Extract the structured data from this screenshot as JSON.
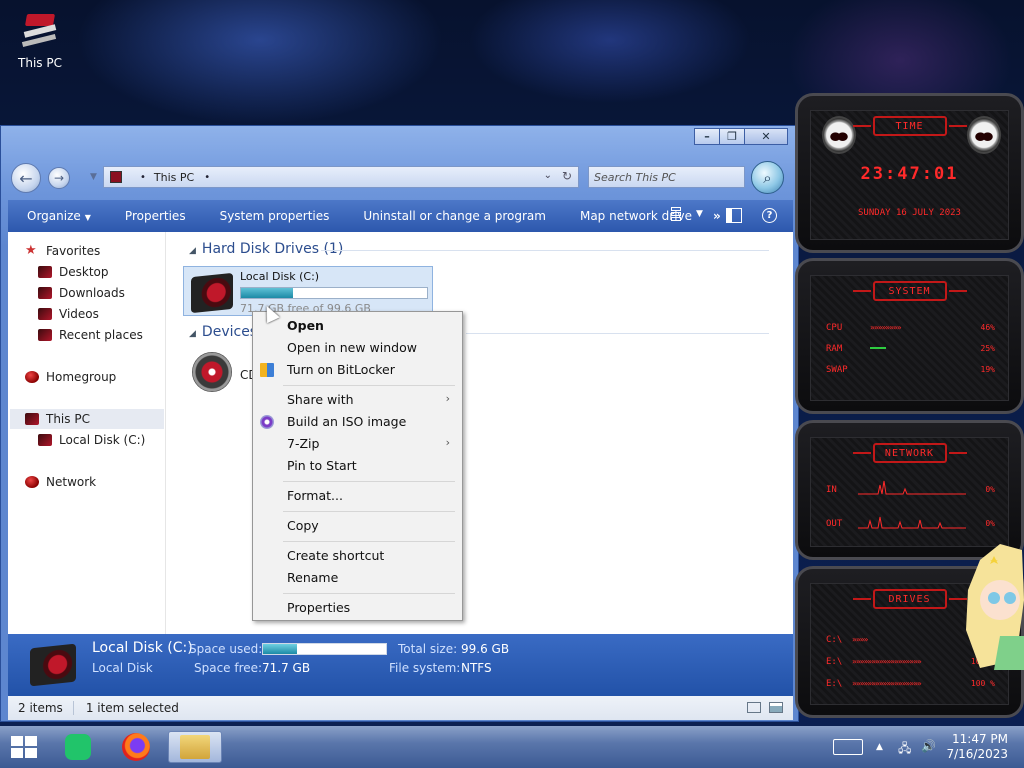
{
  "desktop": {
    "this_pc_label": "This PC"
  },
  "window": {
    "address": {
      "location": "This PC",
      "separator": "•"
    },
    "search_placeholder": "Search This PC",
    "caption_buttons": {
      "minimize": "–",
      "maximize": "❐",
      "close": "✕"
    },
    "commands": {
      "organize": "Organize",
      "properties": "Properties",
      "system_properties": "System properties",
      "uninstall": "Uninstall or change a program",
      "map_drive": "Map network drive",
      "more": "»"
    },
    "nav": {
      "favorites": "Favorites",
      "desktop": "Desktop",
      "downloads": "Downloads",
      "videos": "Videos",
      "recent": "Recent places",
      "homegroup": "Homegroup",
      "this_pc": "This PC",
      "local_disk": "Local Disk (C:)",
      "network": "Network"
    },
    "groups": {
      "hdd": "Hard Disk Drives (1)",
      "devices": "Devices w"
    },
    "drive": {
      "name": "Local Disk (C:)",
      "free_text": "71.7 GB free of 99.6 GB",
      "used_fraction": 0.28
    },
    "cd": {
      "label": "CD"
    },
    "details": {
      "name": "Local Disk (C:)",
      "type": "Local Disk",
      "space_used_label": "Space used:",
      "space_free_label": "Space free:",
      "space_free": "71.7 GB",
      "total_size_label": "Total size:",
      "total_size": "99.6 GB",
      "file_system_label": "File system:",
      "file_system": "NTFS",
      "used_fraction": 0.28
    },
    "status": {
      "items": "2 items",
      "selected": "1 item selected"
    }
  },
  "context_menu": {
    "open": "Open",
    "open_new_window": "Open in new window",
    "bitlocker": "Turn on BitLocker",
    "share_with": "Share with",
    "build_iso": "Build an ISO image",
    "seven_zip": "7-Zip",
    "pin_start": "Pin to Start",
    "format": "Format...",
    "copy": "Copy",
    "create_shortcut": "Create shortcut",
    "rename": "Rename",
    "properties": "Properties"
  },
  "widgets": {
    "time": {
      "title": "TIME",
      "clock": "23:47:01",
      "date": "SUNDAY 16 JULY 2023"
    },
    "system": {
      "title": "SYSTEM",
      "rows": [
        {
          "label": "CPU",
          "value": "46%"
        },
        {
          "label": "RAM",
          "value": "25%"
        },
        {
          "label": "SWAP",
          "value": "19%"
        }
      ]
    },
    "network": {
      "title": "NETWORK",
      "rows": [
        {
          "label": "IN",
          "value": "0%"
        },
        {
          "label": "OUT",
          "value": "0%"
        }
      ]
    },
    "drives": {
      "title": "DRIVES",
      "rows": [
        {
          "label": "C:\\",
          "value": ""
        },
        {
          "label": "E:\\",
          "value": "100 %"
        },
        {
          "label": "E:\\",
          "value": "100 %"
        }
      ]
    }
  },
  "taskbar": {
    "time": "11:47 PM",
    "date": "7/16/2023"
  },
  "colors": {
    "accent_red": "#ff2a2a",
    "window_blue": "#5d86cf",
    "command_bar": "#2d58ad"
  }
}
